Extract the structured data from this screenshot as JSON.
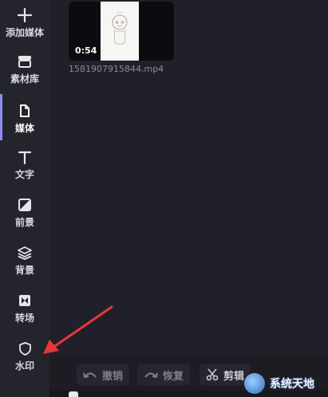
{
  "sidebar": {
    "items": [
      {
        "label": "添加媒体",
        "icon": "plus-icon"
      },
      {
        "label": "素材库",
        "icon": "library-icon"
      },
      {
        "label": "媒体",
        "icon": "file-icon",
        "active": true
      },
      {
        "label": "文字",
        "icon": "text-icon"
      },
      {
        "label": "前景",
        "icon": "foreground-icon"
      },
      {
        "label": "背景",
        "icon": "layers-icon"
      },
      {
        "label": "转场",
        "icon": "transition-icon"
      },
      {
        "label": "水印",
        "icon": "shield-icon"
      }
    ]
  },
  "media": {
    "clip": {
      "duration": "0:54",
      "filename": "1581907915844.mp4"
    }
  },
  "toolbar": {
    "undo_label": "撤销",
    "redo_label": "恢复",
    "cut_label": "剪辑"
  },
  "watermark": {
    "text": "系统天地"
  },
  "colors": {
    "accent": "#8e8af0",
    "arrow": "#e53935",
    "sidebar_bg": "#24242c"
  }
}
